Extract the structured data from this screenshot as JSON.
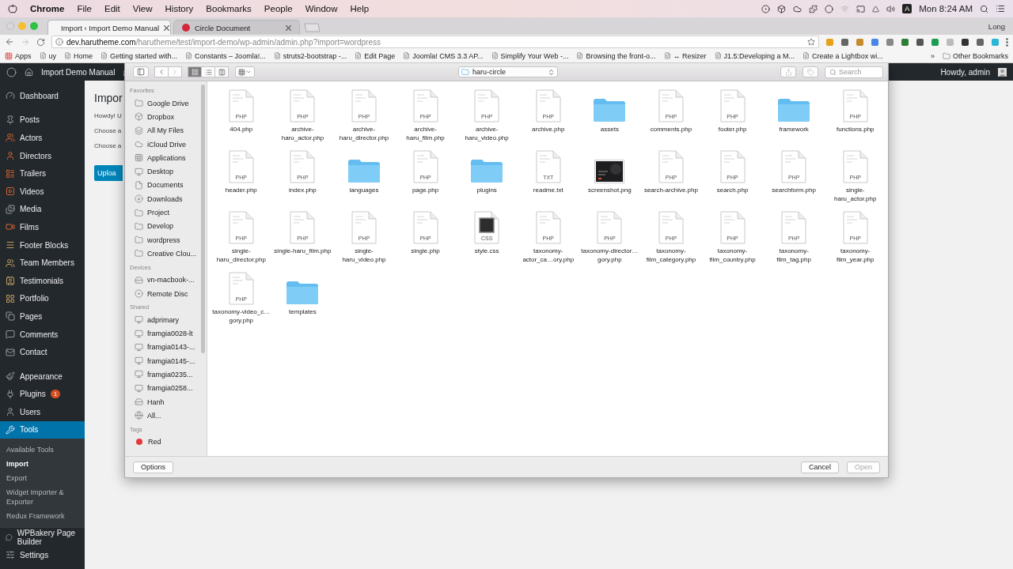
{
  "menu_bar": {
    "app": "Chrome",
    "menus": [
      "File",
      "Edit",
      "View",
      "History",
      "Bookmarks",
      "People",
      "Window",
      "Help"
    ],
    "input_source": "A",
    "clock": "Mon 8:24 AM"
  },
  "browser": {
    "tabs": [
      {
        "title": "Import ‹ Import Demo Manual",
        "selected": true
      },
      {
        "title": "Circle Document",
        "selected": false
      }
    ],
    "profile": "Long",
    "url": {
      "host": "dev.harutheme.com",
      "path": "/harutheme/test/import-demo/wp-admin/admin.php?import=wordpress"
    },
    "bookmarks": [
      "Apps",
      "uy",
      "Home",
      "Getting started with...",
      "Constants – Joomla!...",
      "struts2-bootstrap -...",
      "Edit Page",
      "Joomla! CMS 3.3 AP...",
      "Simplify Your Web -...",
      "Browsing the front-o...",
      "↔ Resizer",
      "J1.5:Developing a M...",
      "Create a Lightbox wi..."
    ],
    "more": "»",
    "other_bookmarks": "Other Bookmarks"
  },
  "admin_bar": {
    "site": "Import Demo Manual",
    "greeting": "Howdy, admin"
  },
  "admin_menu": [
    {
      "items": [
        {
          "label": "Dashboard",
          "selected": false
        }
      ]
    },
    {
      "items": [
        {
          "label": "Posts",
          "selected": false
        },
        {
          "label": "Actors",
          "selected": false
        },
        {
          "label": "Directors",
          "selected": false
        },
        {
          "label": "Trailers",
          "selected": false
        },
        {
          "label": "Videos",
          "selected": false
        },
        {
          "label": "Media",
          "selected": false
        },
        {
          "label": "Films",
          "selected": false
        },
        {
          "label": "Footer Blocks",
          "selected": false
        },
        {
          "label": "Team Members",
          "selected": false
        },
        {
          "label": "Testimonials",
          "selected": false
        },
        {
          "label": "Portfolio",
          "selected": false
        },
        {
          "label": "Pages",
          "selected": false
        },
        {
          "label": "Comments",
          "selected": false
        },
        {
          "label": "Contact",
          "selected": false
        }
      ]
    },
    {
      "items": [
        {
          "label": "Appearance",
          "selected": false
        },
        {
          "label": "Plugins",
          "selected": false,
          "badge": "1"
        },
        {
          "label": "Users",
          "selected": false
        },
        {
          "label": "Tools",
          "selected": true,
          "children": [
            {
              "label": "Available Tools",
              "selected": false
            },
            {
              "label": "Import",
              "selected": true
            },
            {
              "label": "Export",
              "selected": false
            },
            {
              "label": "Widget Importer & Exporter",
              "selected": false
            },
            {
              "label": "Redux Framework",
              "selected": false
            }
          ]
        },
        {
          "label": "WPBakery Page Builder",
          "selected": false
        },
        {
          "label": "Settings",
          "selected": false
        }
      ]
    }
  ],
  "content": {
    "title": "Impor",
    "lines": [
      "Howdy! U",
      "Choose a",
      "Choose a"
    ],
    "button": "Uploa"
  },
  "dialog": {
    "path": "haru-circle",
    "search": {
      "placeholder": "Search"
    },
    "views": [
      {
        "kind": "icons",
        "selected": true
      },
      {
        "kind": "list",
        "selected": false
      },
      {
        "kind": "columns",
        "selected": false
      }
    ],
    "sidebar": [
      {
        "title": "Favorites",
        "items": [
          {
            "label": "Google Drive",
            "kind": "folder",
            "selected": false
          },
          {
            "label": "Dropbox",
            "kind": "dropbox",
            "selected": false
          },
          {
            "label": "All My Files",
            "kind": "files",
            "selected": false
          },
          {
            "label": "iCloud Drive",
            "kind": "cloud",
            "selected": false
          },
          {
            "label": "Applications",
            "kind": "apps",
            "selected": false
          },
          {
            "label": "Desktop",
            "kind": "desktop",
            "selected": false
          },
          {
            "label": "Documents",
            "kind": "documents",
            "selected": false
          },
          {
            "label": "Downloads",
            "kind": "downloads",
            "selected": false
          },
          {
            "label": "Project",
            "kind": "folder",
            "selected": false
          },
          {
            "label": "Develop",
            "kind": "folder",
            "selected": false
          },
          {
            "label": "wordpress",
            "kind": "folder",
            "selected": false
          },
          {
            "label": "Creative Clou...",
            "kind": "folder",
            "selected": false
          }
        ]
      },
      {
        "title": "Devices",
        "items": [
          {
            "label": "vn-macbook-...",
            "kind": "drive",
            "selected": false
          },
          {
            "label": "Remote Disc",
            "kind": "disc",
            "selected": false
          }
        ]
      },
      {
        "title": "Shared",
        "items": [
          {
            "label": "adprimary",
            "kind": "computer",
            "selected": false
          },
          {
            "label": "framgia0028-lt",
            "kind": "computer",
            "selected": false
          },
          {
            "label": "framgia0143-...",
            "kind": "computer",
            "selected": false
          },
          {
            "label": "framgia0145-...",
            "kind": "computer",
            "selected": false
          },
          {
            "label": "framgia0235...",
            "kind": "computer",
            "selected": false
          },
          {
            "label": "framgia0258...",
            "kind": "computer",
            "selected": false
          },
          {
            "label": "Hanh",
            "kind": "drive",
            "selected": false
          },
          {
            "label": "All...",
            "kind": "network",
            "selected": false
          }
        ]
      },
      {
        "title": "Tags",
        "items": [
          {
            "label": "Red",
            "kind": "tag",
            "color": "#e5383b",
            "selected": false
          }
        ]
      }
    ],
    "files": [
      {
        "name": "404.php",
        "kind": "file",
        "type_label": "PHP",
        "selected": false
      },
      {
        "name": "archive-haru_actor.php",
        "kind": "file",
        "type_label": "PHP",
        "selected": false
      },
      {
        "name": "archive-haru_director.php",
        "kind": "file",
        "type_label": "PHP",
        "selected": false
      },
      {
        "name": "archive-haru_film.php",
        "kind": "file",
        "type_label": "PHP",
        "selected": false
      },
      {
        "name": "archive-haru_video.php",
        "kind": "file",
        "type_label": "PHP",
        "selected": false
      },
      {
        "name": "archive.php",
        "kind": "file",
        "type_label": "PHP",
        "selected": false
      },
      {
        "name": "assets",
        "kind": "folder",
        "selected": false
      },
      {
        "name": "comments.php",
        "kind": "file",
        "type_label": "PHP",
        "selected": false
      },
      {
        "name": "footer.php",
        "kind": "file",
        "type_label": "PHP",
        "selected": false
      },
      {
        "name": "framework",
        "kind": "folder",
        "selected": false
      },
      {
        "name": "functions.php",
        "kind": "file",
        "type_label": "PHP",
        "selected": false
      },
      {
        "name": "header.php",
        "kind": "file",
        "type_label": "PHP",
        "selected": false
      },
      {
        "name": "index.php",
        "kind": "file",
        "type_label": "PHP",
        "selected": false
      },
      {
        "name": "languages",
        "kind": "folder",
        "selected": false
      },
      {
        "name": "page.php",
        "kind": "file",
        "type_label": "PHP",
        "selected": false
      },
      {
        "name": "plugins",
        "kind": "folder",
        "selected": false
      },
      {
        "name": "readme.txt",
        "kind": "file",
        "type_label": "TXT",
        "selected": false
      },
      {
        "name": "screenshot.png",
        "selected": false
      },
      {
        "name": "search-archive.php",
        "kind": "file",
        "type_label": "PHP",
        "selected": false
      },
      {
        "name": "search.php",
        "kind": "file",
        "type_label": "PHP",
        "selected": false
      },
      {
        "name": "searchform.php",
        "kind": "file",
        "type_label": "PHP",
        "selected": false
      },
      {
        "name": "single-haru_actor.php",
        "kind": "file",
        "type_label": "PHP",
        "selected": false
      },
      {
        "name": "single-haru_director.php",
        "kind": "file",
        "type_label": "PHP",
        "selected": false
      },
      {
        "name": "single-haru_film.php",
        "kind": "file",
        "type_label": "PHP",
        "selected": false
      },
      {
        "name": "single-haru_video.php",
        "kind": "file",
        "type_label": "PHP",
        "selected": false
      },
      {
        "name": "single.php",
        "kind": "file",
        "type_label": "PHP",
        "selected": false
      },
      {
        "name": "style.css",
        "kind": "stylesheet",
        "type_label": "CSS",
        "selected": false
      },
      {
        "name": "taxonomy-actor_ca…ory.php",
        "kind": "file",
        "type_label": "PHP",
        "selected": false
      },
      {
        "name": "taxonomy-director…gory.php",
        "kind": "file",
        "type_label": "PHP",
        "selected": false
      },
      {
        "name": "taxonomy-film_category.php",
        "kind": "file",
        "type_label": "PHP",
        "selected": false
      },
      {
        "name": "taxonomy-film_country.php",
        "kind": "file",
        "type_label": "PHP",
        "selected": false
      },
      {
        "name": "taxonomy-film_tag.php",
        "kind": "file",
        "type_label": "PHP",
        "selected": false
      },
      {
        "name": "taxonomy-film_year.php",
        "kind": "file",
        "type_label": "PHP",
        "selected": false
      },
      {
        "name": "taxonomy-video_c…gory.php",
        "kind": "file",
        "type_label": "PHP",
        "selected": false
      },
      {
        "name": "templates",
        "kind": "folder",
        "selected": false
      }
    ],
    "buttons": [
      {
        "label": "Options",
        "disabled": false
      },
      {
        "label": "Cancel",
        "disabled": false
      },
      {
        "label": "Open",
        "disabled": true
      }
    ]
  }
}
